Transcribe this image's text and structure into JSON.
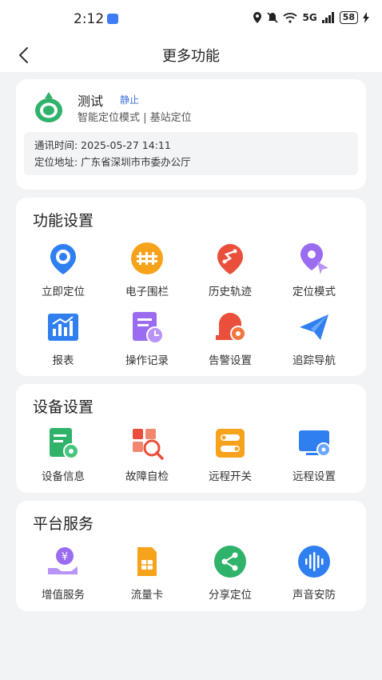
{
  "status_bar": {
    "time": "2:12",
    "signal_text": "5G",
    "battery": "58"
  },
  "nav": {
    "back_label": "<",
    "title": "更多功能"
  },
  "device": {
    "name": "测试",
    "status": "静止",
    "mode": "智能定位模式 | 基站定位",
    "comm_time": "通讯时间:  2025-05-27 14:11",
    "address": "定位地址:  广东省深圳市市委办公厅"
  },
  "sections": {
    "function_settings": {
      "title": "功能设置",
      "items": [
        {
          "label": "立即定位",
          "icon": "locate-now-icon"
        },
        {
          "label": "电子围栏",
          "icon": "geofence-icon"
        },
        {
          "label": "历史轨迹",
          "icon": "history-track-icon"
        },
        {
          "label": "定位模式",
          "icon": "locate-mode-icon"
        },
        {
          "label": "报表",
          "icon": "report-icon"
        },
        {
          "label": "操作记录",
          "icon": "operation-log-icon"
        },
        {
          "label": "告警设置",
          "icon": "alarm-settings-icon"
        },
        {
          "label": "追踪导航",
          "icon": "tracking-navigation-icon"
        }
      ]
    },
    "device_settings": {
      "title": "设备设置",
      "items": [
        {
          "label": "设备信息",
          "icon": "device-info-icon"
        },
        {
          "label": "故障自检",
          "icon": "fault-check-icon"
        },
        {
          "label": "远程开关",
          "icon": "remote-switch-icon"
        },
        {
          "label": "远程设置",
          "icon": "remote-settings-icon"
        }
      ]
    },
    "platform_services": {
      "title": "平台服务",
      "items": [
        {
          "label": "增值服务",
          "icon": "value-added-service-icon"
        },
        {
          "label": "流量卡",
          "icon": "data-card-icon"
        },
        {
          "label": "分享定位",
          "icon": "share-location-icon"
        },
        {
          "label": "声音安防",
          "icon": "sound-security-icon"
        }
      ]
    }
  },
  "colors": {
    "blue": "#2f7ff0",
    "orange": "#f7a21b",
    "red": "#ea4f3c",
    "purple": "#9a6cf0",
    "green": "#2fb26a",
    "status_blue": "#3b6fd6"
  }
}
